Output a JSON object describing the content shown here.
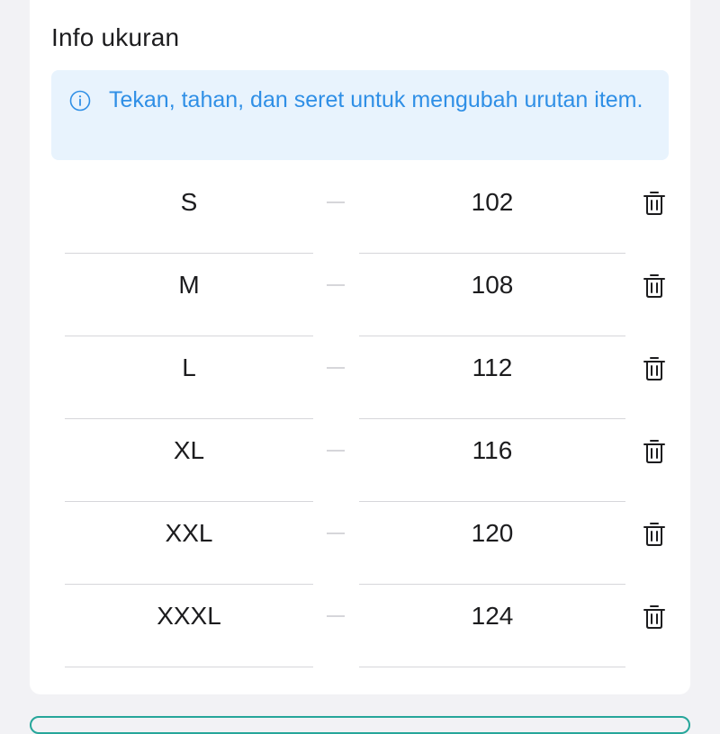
{
  "section": {
    "title": "Info ukuran"
  },
  "info": {
    "icon": "info-circle-icon",
    "text": "Tekan, tahan, dan seret untuk mengubah urutan item.",
    "color": "#2f8fe6",
    "background": "#e8f3fd"
  },
  "rows": [
    {
      "size": "S",
      "value": "102"
    },
    {
      "size": "M",
      "value": "108"
    },
    {
      "size": "L",
      "value": "112"
    },
    {
      "size": "XL",
      "value": "116"
    },
    {
      "size": "XXL",
      "value": "120"
    },
    {
      "size": "XXXL",
      "value": "124"
    }
  ],
  "row_action_icon": "trash-icon",
  "accent_color": "#26a69a"
}
